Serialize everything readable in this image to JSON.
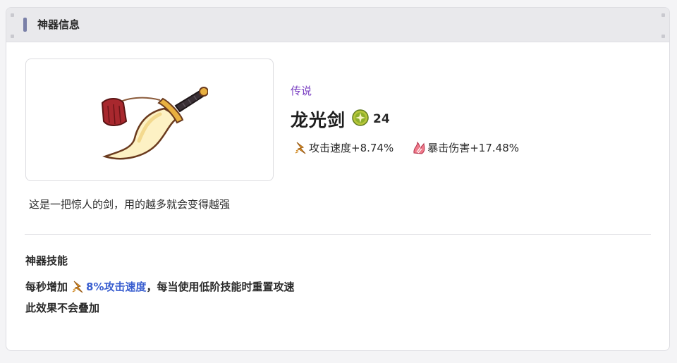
{
  "header": {
    "title": "神器信息"
  },
  "artifact": {
    "rarity": "传说",
    "name": "龙光剑",
    "level": "24",
    "stats": [
      {
        "icon": "attack-speed-icon",
        "label": "攻击速度+8.74%"
      },
      {
        "icon": "crit-damage-icon",
        "label": "暴击伤害+17.48%"
      }
    ],
    "description": "这是一把惊人的剑，用的越多就会变得越强"
  },
  "skill": {
    "section_title": "神器技能",
    "line1_prefix": "每秒增加",
    "highlight": "8%攻击速度",
    "line1_suffix": "，每当使用低阶技能时重置攻速",
    "line2": "此效果不会叠加"
  },
  "colors": {
    "rarity": "#7a3fc2",
    "highlight": "#3a5fd0",
    "header_bar": "#7a80a8"
  }
}
